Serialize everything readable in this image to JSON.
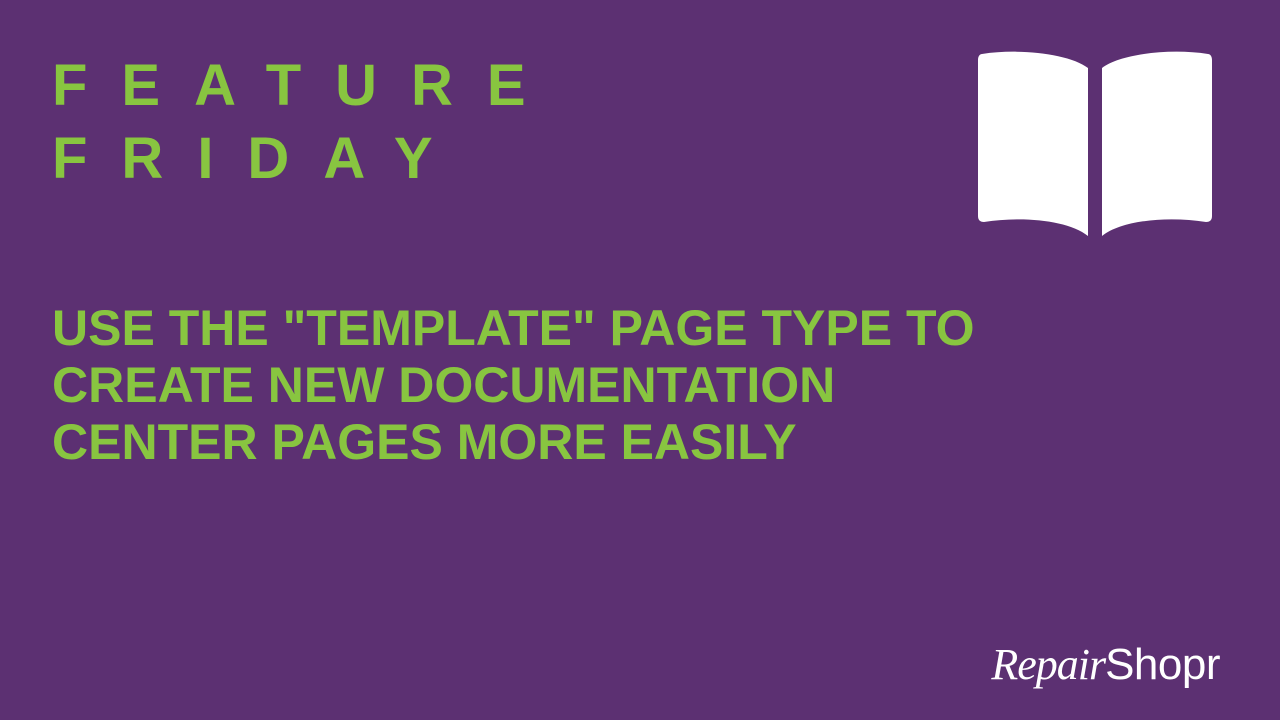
{
  "title_line1": "FEATURE",
  "title_line2": "FRIDAY",
  "subtitle": "USE THE \"TEMPLATE\" PAGE TYPE TO CREATE NEW DOCUMENTATION CENTER PAGES MORE EASILY",
  "brand_script": "Repair",
  "brand_plain": "Shopr",
  "colors": {
    "background": "#5c3072",
    "accent": "#88c540",
    "icon": "#ffffff",
    "brand_text": "#ffffff"
  },
  "icon": "book-open-icon"
}
